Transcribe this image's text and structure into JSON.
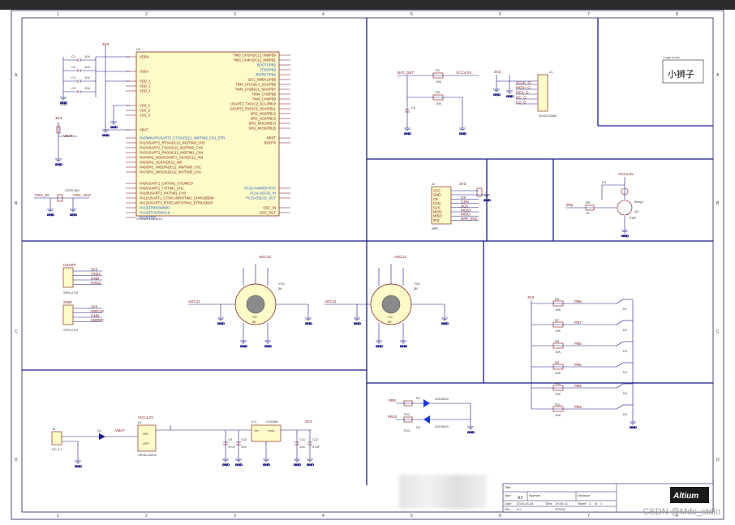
{
  "colors": {
    "wire": "#1a1a8c",
    "frame": "#1c1c5c",
    "part": "#7a1010",
    "body_fill": "#fdfbc8",
    "led": "#1a3ad1"
  },
  "grid": {
    "cols": [
      "1",
      "2",
      "3",
      "4",
      "5",
      "6",
      "7",
      "8"
    ],
    "rows": [
      "A",
      "B",
      "C",
      "D"
    ]
  },
  "logo_box": {
    "title": "Logo-Icon1",
    "text": "小狮子"
  },
  "mcu": {
    "ref": "U1",
    "part": "STM32F103C8T6",
    "left_pins": [
      "VBAT",
      "VDDA",
      "VSSA",
      "VDD_1",
      "VDD_2",
      "VDD_3",
      "VSS_1",
      "VSS_2",
      "VSS_3"
    ],
    "right_pins": [
      "TIM3_CH3/ADC12_IN8/PB0",
      "TIM3_CH4/ADC12_IN9/PB1",
      "BOOT1/PB2",
      "JTDO/PB3",
      "JNTRST/PB4",
      "I2C1_SMBAL/PB5",
      "TIM4_CH1/I2C1_SCL/PB6",
      "TIM4_CH2/I2C1_SDA/PB7",
      "TIM4_CH3/PB8",
      "TIM4_CH4/PB9",
      "USART3_TX/I2C2_SCL/PB10",
      "USART3_RX/I2C2_SDA/PB11",
      "SPI2_NSS/PB12",
      "SPI2_SCK/PB13",
      "SPI2_MISO/PB14",
      "SPI2_MOSI/PB15"
    ],
    "pa_pins": [
      "PA0/WKUP/USART2_CTS/ADC12_IN0/TIM2_CH1_ETR",
      "PA1/USART2_RTS/ADC12_IN1/TIM2_CH2",
      "PA2/USART2_TX/ADC12_IN2/TIM2_CH3",
      "PA3/USART2_RX/ADC12_IN3/TIM2_CH4",
      "PA4/SPI1_NSS/USART2_CK/ADC12_IN4",
      "PA5/SPI1_SCK/ADC12_IN5",
      "PA6/SPI1_MISO/ADC12_IN6/TIM3_CH1",
      "PA7/SPI1_MOSI/ADC12_IN7/TIM3_CH2",
      "PA8/USART1_CK/TIM1_CH1/MCO",
      "PA9/USART1_TX/TIM1_CH2",
      "PA10/USART1_RX/TIM1_CH3",
      "PA11/USART1_CTS/CANRX/TIM1_CH4/USBDM",
      "PA12/USART1_RTS/CANTX/TIM1_ETR/USBDP",
      "PA13/JTMS/SWDIO",
      "PA14/JTCK/SWCLK",
      "PA15/JTDI"
    ],
    "right_lower": [
      "NRST",
      "BOOT0",
      "PC13-TAMPER-RTC",
      "PC14-OSC32_IN",
      "PC15-OSC32_OUT",
      "OSC_IN",
      "OSC_OUT"
    ]
  },
  "nets": {
    "bat_det": "BAT_DET",
    "strap": "STRAP",
    "vcc": "VCC4.2V",
    "v3": "3V3",
    "vbat": "VBAT",
    "osc_in": "OSC_IN",
    "osc_out": "OSC_OUT",
    "adc11": "ADC11",
    "adc12": "ADC12",
    "irq": "IRQ",
    "nrst": "NRST",
    "boot0": "BOOT0"
  },
  "caps_left": [
    "C1",
    "C2",
    "C3",
    "C4"
  ],
  "cap_value": "104",
  "battery": {
    "r1": "R1",
    "r2": "R2",
    "val": "10K",
    "c5": "C5"
  },
  "oled": {
    "ref": "J1",
    "part": "OLED12864",
    "pins": [
      "SCLK_O",
      "MOSI_O",
      "RES_O",
      "DC_O",
      "CS_O"
    ]
  },
  "nrf": {
    "ref": "J2",
    "part": "NRF",
    "pins": [
      "VCC",
      "GND",
      "CE",
      "CSN",
      "SCK",
      "MOSI",
      "MISO",
      "IRQ"
    ]
  },
  "buzzer": {
    "ref": "Q1",
    "part": "PNP",
    "label": "Beep1",
    "r": "R5",
    "rv": "1K",
    "d": "D3"
  },
  "usart": {
    "ref": "J4",
    "part": "SIP4-2.54",
    "pins": [
      "3V3",
      "TXD1",
      "GND",
      "RXD1"
    ],
    "title": "USART"
  },
  "swd": {
    "ref": "J5",
    "part": "SIP4-2.54",
    "pins": [
      "3V3",
      "SWCLK",
      "GND",
      "SWDIO"
    ],
    "title": "SWD"
  },
  "joystick1": {
    "ref": "YG1",
    "val": "5K",
    "label": "YG",
    "sub": "5K"
  },
  "joystick2": {
    "ref": "YG2",
    "val": "5K",
    "label": "YG",
    "sub": "5K"
  },
  "keys": [
    {
      "ref": "K1",
      "net": "PB8",
      "r": "R6"
    },
    {
      "ref": "K2",
      "net": "PB7",
      "r": "R7"
    },
    {
      "ref": "K3",
      "net": "PB6",
      "r": "R8"
    },
    {
      "ref": "K4",
      "net": "PB5",
      "r": "R9"
    },
    {
      "ref": "K5",
      "net": "PB4",
      "r": "R10"
    },
    {
      "ref": "K6",
      "net": "PB3",
      "r": "R11"
    }
  ],
  "key_r_val": "10K",
  "leds": {
    "d1": "D1",
    "d2": "D2",
    "led": "LED0603",
    "r12": "R12",
    "r13": "R13",
    "v": "1K",
    "pb": "PB9",
    "pb2": "PB10"
  },
  "power": {
    "j3": "J3",
    "dc": "DC-4.2",
    "d1": "D1",
    "k1": "K1",
    "sw": "SK08-13U02",
    "ic": "IC1",
    "ic_part": "XC6206",
    "vin": "Vin",
    "vout": "Vout",
    "on": "ON",
    "off": "OFF",
    "caps": [
      "C9",
      "C10",
      "C11",
      "C12"
    ],
    "cap_vals": [
      "47uF",
      "104",
      "104",
      "47uF"
    ]
  },
  "title_block": {
    "title_label": "Title",
    "size_label": "Size",
    "size": "A3",
    "number_label": "Number",
    "revision_label": "Revision",
    "date_label": "Date",
    "date": "2020-04-04",
    "time_label": "Time",
    "time": "19:40:13",
    "sheet_label": "Sheet",
    "sheet": "1",
    "of_label": "of",
    "of": "1",
    "file_label": "File",
    "file": "D:\\",
    "file2": "STM32",
    "logo": "Altium"
  },
  "watermark": "CSDN @Mdc_stdio"
}
